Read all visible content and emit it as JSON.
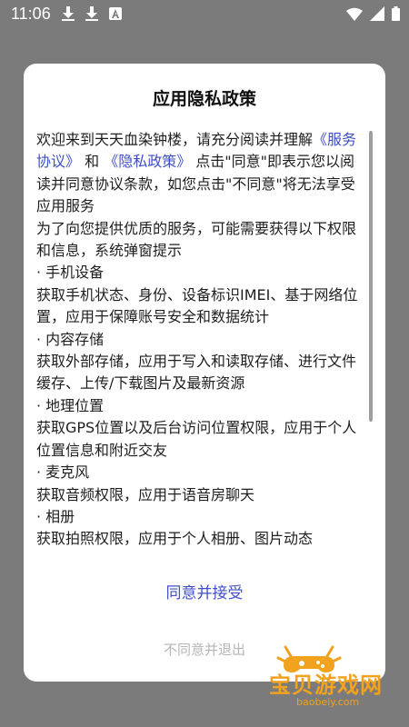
{
  "status_bar": {
    "time": "11:06",
    "icons": [
      "download-icon",
      "download-icon",
      "a-icon",
      "wifi-icon",
      "signal-icon",
      "battery-icon"
    ]
  },
  "dialog": {
    "title": "应用隐私政策",
    "intro_text": "欢迎来到天天血染钟楼，请充分阅读并理解",
    "link_service": "《服务协议》",
    "and_text": " 和 ",
    "link_privacy": "《隐私政策》",
    "intro_text_2": " 点击\"同意\"即表示您以阅读并同意协议条款，如您点击\"不同意\"将无法享受应用服务",
    "paragraph_2": "为了向您提供优质的服务，可能需要获得以下权限和信息，系统弹窗提示",
    "items": [
      {
        "heading": "· 手机设备",
        "desc": "获取手机状态、身份、设备标识IMEI、基于网络位置，应用于保障账号安全和数据统计"
      },
      {
        "heading": "· 内容存储",
        "desc": "获取外部存储，应用于写入和读取存储、进行文件缓存、上传/下载图片及最新资源"
      },
      {
        "heading": "· 地理位置",
        "desc": "获取GPS位置以及后台访问位置权限，应用于个人位置信息和附近交友"
      },
      {
        "heading": "· 麦克风",
        "desc": "获取音频权限，应用于语音房聊天"
      },
      {
        "heading": "· 相册",
        "desc": "获取拍照权限，应用于个人相册、图片动态"
      }
    ],
    "agree_label": "同意并接受",
    "disagree_label": "不同意并退出"
  },
  "watermark": {
    "text": "宝贝游戏网",
    "url": "baobeiy.com"
  },
  "colors": {
    "link": "#3f4fc7",
    "agree": "#3f4fc7",
    "disagree": "#b5b5b5",
    "overlay": "#7b7b7b",
    "watermark": "#f1a21f"
  }
}
